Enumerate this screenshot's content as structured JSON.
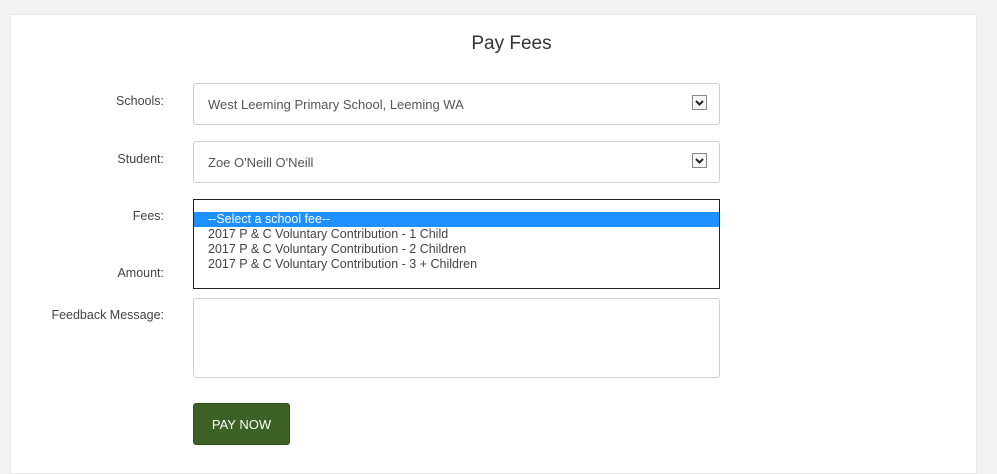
{
  "page": {
    "title": "Pay Fees"
  },
  "form": {
    "schools": {
      "label": "Schools:",
      "value": "West Leeming Primary School, Leeming WA"
    },
    "student": {
      "label": "Student:",
      "value": "Zoe O'Neill O'Neill"
    },
    "fees": {
      "label": "Fees:",
      "options": [
        "--Select a school fee--",
        "2017 P & C Voluntary Contribution - 1 Child",
        "2017 P & C Voluntary Contribution - 2 Children",
        "2017 P & C Voluntary Contribution - 3 + Children"
      ],
      "selected_index": 0
    },
    "amount": {
      "label": "Amount:"
    },
    "feedback": {
      "label": "Feedback Message:",
      "value": ""
    },
    "pay_button_label": "PAY NOW"
  },
  "colors": {
    "accent_button": "#3b6125",
    "selected_option": "#1e90ff"
  },
  "icons": {
    "dropdown": "chevron-down-icon"
  }
}
